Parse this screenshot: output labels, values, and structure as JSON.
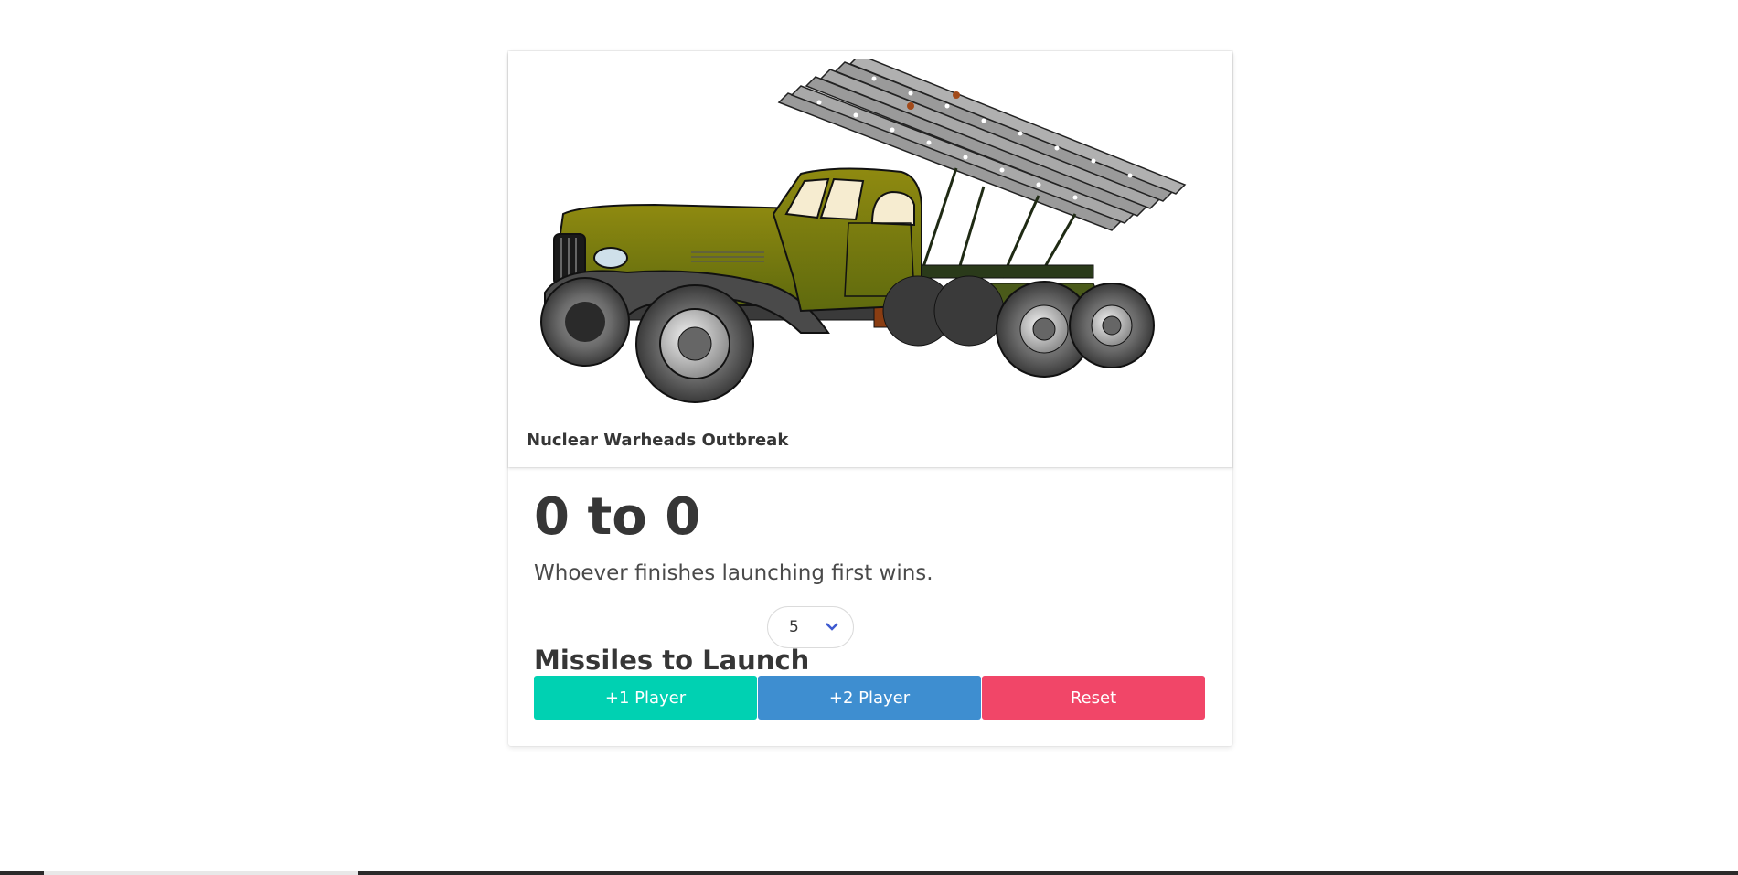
{
  "hero": {
    "caption": "Nuclear Warheads Outbreak",
    "image_icon": "rocket-launcher-truck-illustration"
  },
  "scoreboard": {
    "score_text": "0 to 0",
    "subtitle": "Whoever finishes launching first wins."
  },
  "missiles": {
    "label": "Missiles to Launch",
    "selected_value": "5",
    "dropdown_icon": "chevron-down-icon"
  },
  "buttons": {
    "player1_label": "+1 Player",
    "player2_label": "+2 Player",
    "reset_label": "Reset"
  },
  "colors": {
    "player1": "#00d1b2",
    "player2": "#3e8ed0",
    "reset": "#f14668",
    "text": "#363636"
  }
}
